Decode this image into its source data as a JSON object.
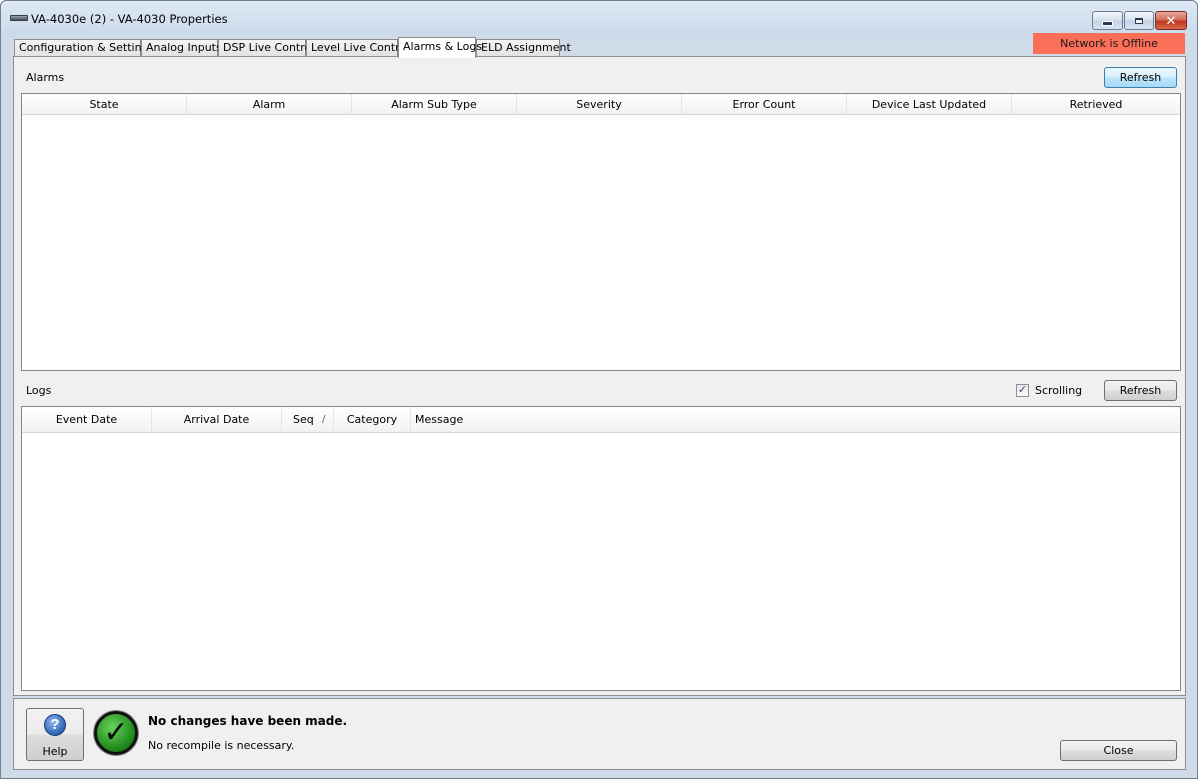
{
  "window": {
    "title": "VA-4030e (2) - VA-4030 Properties",
    "controls": {
      "minimize": "",
      "maximize": "",
      "close": "✕"
    }
  },
  "tabs": [
    {
      "label": "Configuration & Settings"
    },
    {
      "label": "Analog Inputs"
    },
    {
      "label": "DSP Live Control"
    },
    {
      "label": "Level Live Control"
    },
    {
      "label": "Alarms & Logs",
      "active": true
    },
    {
      "label": "ELD Assignment"
    }
  ],
  "network_status": {
    "text": "Network is Offline",
    "color": "#fb6e58"
  },
  "alarms": {
    "label": "Alarms",
    "refresh_label": "Refresh",
    "columns": [
      "State",
      "Alarm",
      "Alarm Sub Type",
      "Severity",
      "Error Count",
      "Device Last Updated",
      "Retrieved"
    ],
    "rows": []
  },
  "logs": {
    "label": "Logs",
    "scrolling_label": "Scrolling",
    "scrolling_checked": true,
    "refresh_label": "Refresh",
    "columns": [
      "Event Date",
      "Arrival Date",
      "Seq",
      "Category",
      "Message"
    ],
    "sort_indicator": "/",
    "rows": []
  },
  "footer": {
    "help_label": "Help",
    "help_icon": "question-icon",
    "status_icon": "checkmark-icon",
    "message_main": "No changes have been made.",
    "message_sub": "No recompile is necessary.",
    "close_label": "Close"
  }
}
